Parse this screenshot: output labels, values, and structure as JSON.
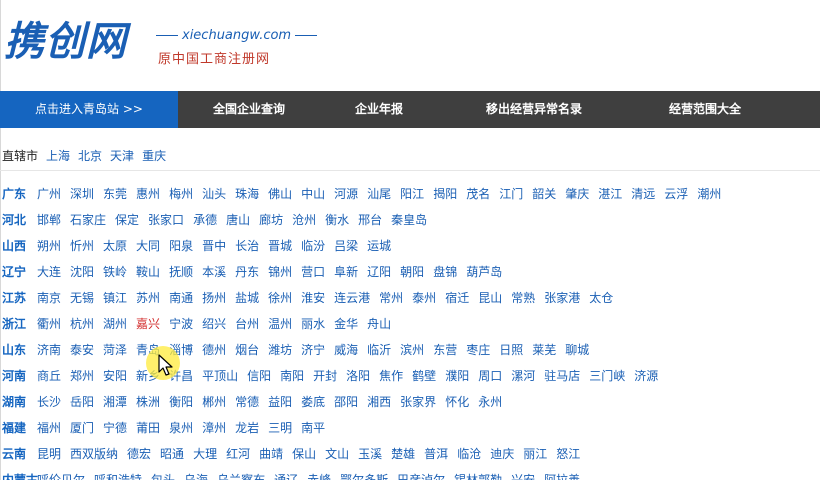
{
  "header": {
    "logo": "携创网",
    "domain": "xiechuangw.com",
    "subtitle": "原中国工商注册网"
  },
  "nav": [
    {
      "label": "点击进入青岛站 >>",
      "active": true
    },
    {
      "label": "全国企业查询"
    },
    {
      "label": "企业年报"
    },
    {
      "label": "移出经营异常名录"
    },
    {
      "label": "经营范围大全"
    }
  ],
  "direct_cities": {
    "label": "直辖市",
    "items": [
      "上海",
      "北京",
      "天津",
      "重庆"
    ]
  },
  "provinces": [
    {
      "name": "广东",
      "cities": [
        "广州",
        "深圳",
        "东莞",
        "惠州",
        "梅州",
        "汕头",
        "珠海",
        "佛山",
        "中山",
        "河源",
        "汕尾",
        "阳江",
        "揭阳",
        "茂名",
        "江门",
        "韶关",
        "肇庆",
        "湛江",
        "清远",
        "云浮",
        "潮州"
      ]
    },
    {
      "name": "河北",
      "cities": [
        "邯郸",
        "石家庄",
        "保定",
        "张家口",
        "承德",
        "唐山",
        "廊坊",
        "沧州",
        "衡水",
        "邢台",
        "秦皇岛"
      ]
    },
    {
      "name": "山西",
      "cities": [
        "朔州",
        "忻州",
        "太原",
        "大同",
        "阳泉",
        "晋中",
        "长治",
        "晋城",
        "临汾",
        "吕梁",
        "运城"
      ]
    },
    {
      "name": "辽宁",
      "cities": [
        "大连",
        "沈阳",
        "铁岭",
        "鞍山",
        "抚顺",
        "本溪",
        "丹东",
        "锦州",
        "营口",
        "阜新",
        "辽阳",
        "朝阳",
        "盘锦",
        "葫芦岛"
      ]
    },
    {
      "name": "江苏",
      "cities": [
        "南京",
        "无锡",
        "镇江",
        "苏州",
        "南通",
        "扬州",
        "盐城",
        "徐州",
        "淮安",
        "连云港",
        "常州",
        "泰州",
        "宿迁",
        "昆山",
        "常熟",
        "张家港",
        "太仓"
      ]
    },
    {
      "name": "浙江",
      "cities": [
        "衢州",
        "杭州",
        "湖州",
        "嘉兴",
        "宁波",
        "绍兴",
        "台州",
        "温州",
        "丽水",
        "金华",
        "舟山"
      ]
    },
    {
      "name": "山东",
      "cities": [
        "济南",
        "泰安",
        "菏泽",
        "青岛",
        "淄博",
        "德州",
        "烟台",
        "潍坊",
        "济宁",
        "威海",
        "临沂",
        "滨州",
        "东营",
        "枣庄",
        "日照",
        "莱芜",
        "聊城"
      ]
    },
    {
      "name": "河南",
      "cities": [
        "商丘",
        "郑州",
        "安阳",
        "新乡",
        "许昌",
        "平顶山",
        "信阳",
        "南阳",
        "开封",
        "洛阳",
        "焦作",
        "鹤壁",
        "濮阳",
        "周口",
        "漯河",
        "驻马店",
        "三门峡",
        "济源"
      ]
    },
    {
      "name": "湖南",
      "cities": [
        "长沙",
        "岳阳",
        "湘潭",
        "株洲",
        "衡阳",
        "郴州",
        "常德",
        "益阳",
        "娄底",
        "邵阳",
        "湘西",
        "张家界",
        "怀化",
        "永州"
      ]
    },
    {
      "name": "福建",
      "cities": [
        "福州",
        "厦门",
        "宁德",
        "莆田",
        "泉州",
        "漳州",
        "龙岩",
        "三明",
        "南平"
      ]
    },
    {
      "name": "云南",
      "cities": [
        "昆明",
        "西双版纳",
        "德宏",
        "昭通",
        "大理",
        "红河",
        "曲靖",
        "保山",
        "文山",
        "玉溪",
        "楚雄",
        "普洱",
        "临沧",
        "迪庆",
        "丽江",
        "怒江"
      ]
    },
    {
      "name": "内蒙古",
      "cities": [
        "呼伦贝尔",
        "呼和浩特",
        "包头",
        "乌海",
        "乌兰察布",
        "通辽",
        "赤峰",
        "鄂尔多斯",
        "巴彦淖尔",
        "锡林郭勒",
        "兴安",
        "阿拉善"
      ]
    }
  ],
  "highlight_city": "嘉兴",
  "colors": {
    "brand_blue": "#1a5fb4",
    "nav_bg": "#3f3f3f",
    "nav_active": "#1565c0",
    "link_blue": "#1a5fb4",
    "highlight_red": "#d32f2f"
  },
  "cursor": {
    "icon": "mouse-pointer-icon"
  }
}
